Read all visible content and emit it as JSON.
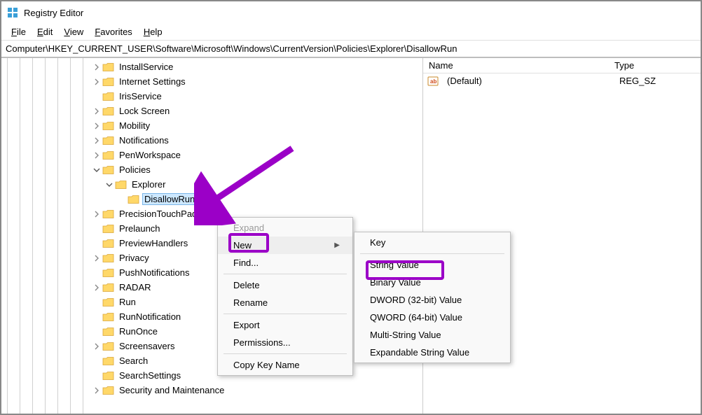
{
  "titlebar": {
    "title": "Registry Editor"
  },
  "menubar": {
    "file": "File",
    "edit": "Edit",
    "view": "View",
    "favorites": "Favorites",
    "help": "Help"
  },
  "pathbar": {
    "path": "Computer\\HKEY_CURRENT_USER\\Software\\Microsoft\\Windows\\CurrentVersion\\Policies\\Explorer\\DisallowRun"
  },
  "tree": {
    "items": [
      {
        "label": "InstallService",
        "indent": 7,
        "exp": "closed"
      },
      {
        "label": "Internet Settings",
        "indent": 7,
        "exp": "closed"
      },
      {
        "label": "IrisService",
        "indent": 7,
        "exp": "none"
      },
      {
        "label": "Lock Screen",
        "indent": 7,
        "exp": "closed"
      },
      {
        "label": "Mobility",
        "indent": 7,
        "exp": "closed"
      },
      {
        "label": "Notifications",
        "indent": 7,
        "exp": "closed"
      },
      {
        "label": "PenWorkspace",
        "indent": 7,
        "exp": "closed"
      },
      {
        "label": "Policies",
        "indent": 7,
        "exp": "open"
      },
      {
        "label": "Explorer",
        "indent": 8,
        "exp": "open"
      },
      {
        "label": "DisallowRun",
        "indent": 9,
        "exp": "none",
        "selected": true
      },
      {
        "label": "PrecisionTouchPad",
        "indent": 7,
        "exp": "closed"
      },
      {
        "label": "Prelaunch",
        "indent": 7,
        "exp": "none"
      },
      {
        "label": "PreviewHandlers",
        "indent": 7,
        "exp": "none"
      },
      {
        "label": "Privacy",
        "indent": 7,
        "exp": "closed"
      },
      {
        "label": "PushNotifications",
        "indent": 7,
        "exp": "none"
      },
      {
        "label": "RADAR",
        "indent": 7,
        "exp": "closed"
      },
      {
        "label": "Run",
        "indent": 7,
        "exp": "none"
      },
      {
        "label": "RunNotification",
        "indent": 7,
        "exp": "none"
      },
      {
        "label": "RunOnce",
        "indent": 7,
        "exp": "none"
      },
      {
        "label": "Screensavers",
        "indent": 7,
        "exp": "closed"
      },
      {
        "label": "Search",
        "indent": 7,
        "exp": "none"
      },
      {
        "label": "SearchSettings",
        "indent": 7,
        "exp": "none"
      },
      {
        "label": "Security and Maintenance",
        "indent": 7,
        "exp": "closed"
      }
    ]
  },
  "list": {
    "headers": {
      "name": "Name",
      "type": "Type"
    },
    "rows": [
      {
        "name": "(Default)",
        "type": "REG_SZ"
      }
    ]
  },
  "ctx1": {
    "expand": "Expand",
    "new": "New",
    "find": "Find...",
    "delete": "Delete",
    "rename": "Rename",
    "export": "Export",
    "permissions": "Permissions...",
    "copy": "Copy Key Name"
  },
  "ctx2": {
    "key": "Key",
    "string": "String Value",
    "binary": "Binary Value",
    "dword": "DWORD (32-bit) Value",
    "qword": "QWORD (64-bit) Value",
    "multi": "Multi-String Value",
    "expand": "Expandable String Value"
  }
}
